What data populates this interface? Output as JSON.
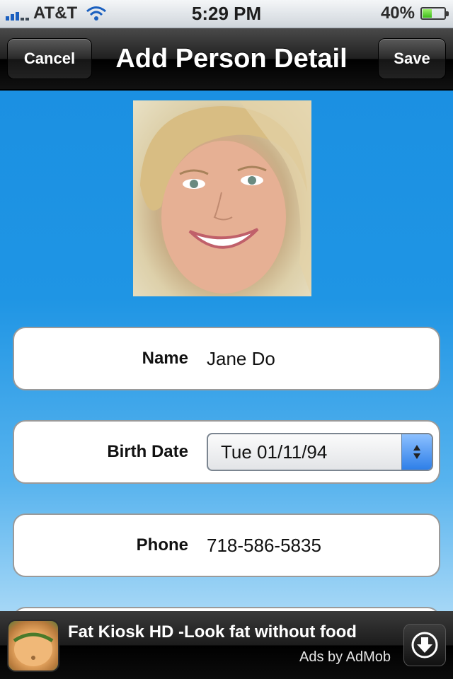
{
  "status_bar": {
    "carrier": "AT&T",
    "time": "5:29 PM",
    "battery_percent": "40%",
    "battery_level": 0.4,
    "icons": [
      "signal-bars-icon",
      "wifi-icon",
      "battery-icon"
    ]
  },
  "nav": {
    "title": "Add Person Detail",
    "cancel_label": "Cancel",
    "save_label": "Save"
  },
  "form": {
    "name": {
      "label": "Name",
      "value": "Jane Do"
    },
    "birth_date": {
      "label": "Birth Date",
      "value": "Tue 01/11/94"
    },
    "phone": {
      "label": "Phone",
      "value": "718-586-5835"
    }
  },
  "ad": {
    "title": "Fat Kiosk HD -Look fat without food",
    "subtitle": "Ads by AdMob",
    "icon": "download-icon"
  },
  "colors": {
    "background_blue": "#1a8fe0",
    "navbar": "#1c1c1c",
    "card": "#ffffff",
    "picker_accent": "#2e7fe8"
  }
}
